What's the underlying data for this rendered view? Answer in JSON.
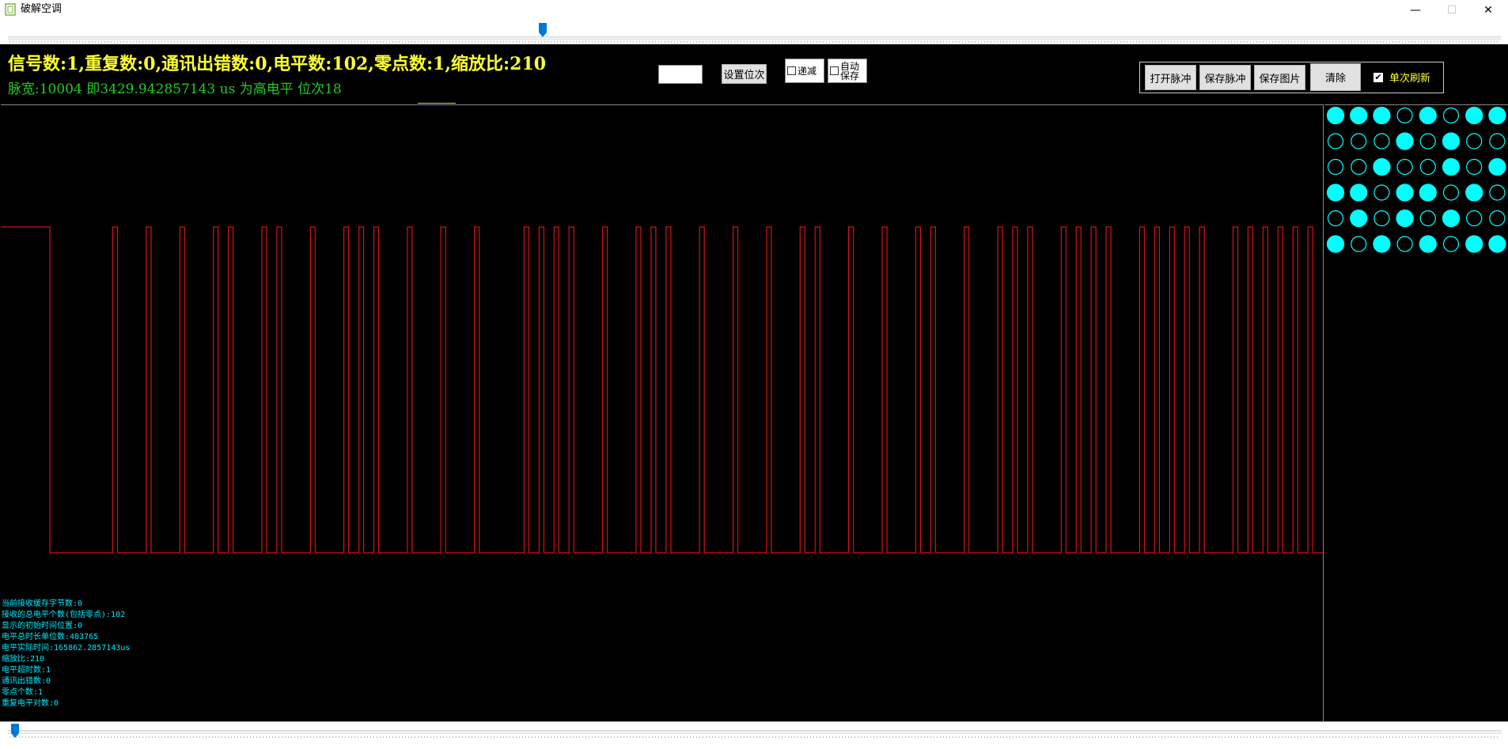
{
  "window": {
    "title": "破解空调",
    "minimize_glyph": "—",
    "maximize_glyph": "☐",
    "close_glyph": "✕"
  },
  "header": {
    "summary": "信号数:1,重复数:0,通讯出错数:0,电平数:102,零点数:1,缩放比:210",
    "pulse_info": "脉宽:10004 即3429.942857143 us   为高电平 位次18"
  },
  "controls": {
    "position_value": "",
    "set_position_label": "设置位次",
    "decrement_label": "递减",
    "auto_save_label": "自动\n保存",
    "open_pulse_label": "打开脉冲",
    "save_pulse_label": "保存脉冲",
    "save_image_label": "保存图片",
    "clear_label": "清除",
    "single_refresh_label": "单次刷新",
    "single_refresh_checked": true
  },
  "sliders": {
    "top_position": 0.36,
    "bottom_position": 0.0
  },
  "waveform": {
    "levels": [
      1,
      0,
      1,
      0,
      1,
      0,
      1,
      0,
      1,
      0,
      1,
      0,
      1,
      0,
      1,
      0,
      1,
      0,
      1,
      0,
      1,
      0,
      1,
      0,
      1,
      0,
      1,
      0,
      1,
      0,
      1,
      0,
      1,
      0,
      1,
      0,
      1,
      0,
      1,
      0,
      1,
      0,
      1,
      0,
      1,
      0,
      1,
      0,
      1,
      0,
      1,
      0,
      1,
      0,
      1,
      0,
      1,
      0,
      1,
      0,
      1,
      0,
      1,
      0,
      1,
      0,
      1,
      0,
      1,
      0,
      1,
      0,
      1,
      0,
      1,
      0,
      1,
      0,
      1,
      0,
      1,
      0,
      1,
      0,
      1,
      0,
      1,
      0,
      1,
      0,
      1,
      0,
      1,
      0,
      1,
      0,
      1,
      0,
      1,
      0,
      1,
      0
    ],
    "durations": [
      82,
      105,
      8,
      48,
      8,
      48,
      8,
      48,
      8,
      17,
      8,
      48,
      8,
      17,
      8,
      48,
      8,
      48,
      8,
      17,
      8,
      17,
      8,
      48,
      8,
      48,
      8,
      48,
      8,
      75,
      8,
      17,
      8,
      17,
      8,
      17,
      8,
      48,
      8,
      48,
      8,
      17,
      8,
      17,
      8,
      48,
      8,
      48,
      8,
      48,
      8,
      48,
      8,
      17,
      8,
      48,
      8,
      48,
      8,
      48,
      8,
      17,
      8,
      48,
      8,
      48,
      8,
      17,
      8,
      17,
      8,
      48,
      8,
      17,
      8,
      17,
      8,
      17,
      8,
      48,
      8,
      17,
      8,
      17,
      8,
      17,
      8,
      17,
      8,
      48,
      8,
      17,
      8,
      17,
      8,
      17,
      8,
      17,
      8,
      17,
      8,
      17
    ],
    "color": "#dd1010"
  },
  "bit_grid": {
    "on_color": "#00ffff",
    "rows": [
      [
        1,
        1,
        1,
        0,
        1,
        0,
        1,
        1
      ],
      [
        0,
        0,
        0,
        1,
        0,
        1,
        0,
        0
      ],
      [
        0,
        0,
        1,
        0,
        0,
        1,
        0,
        1
      ],
      [
        1,
        1,
        0,
        1,
        1,
        0,
        1,
        0
      ],
      [
        0,
        1,
        0,
        1,
        0,
        1,
        0,
        0
      ],
      [
        1,
        0,
        1,
        0,
        1,
        0,
        1,
        1
      ]
    ]
  },
  "stats": [
    "当前接收缓存字节数:0",
    "接收的总电平个数(包括零点):102",
    "显示的初始时间位置:0",
    "电平总时长单位数:483765",
    "电平实际时间:165862.2857143us",
    "缩放比:210",
    "电平超时数:1",
    "通讯出错数:0",
    "零点个数:1",
    "重复电平对数:0"
  ]
}
